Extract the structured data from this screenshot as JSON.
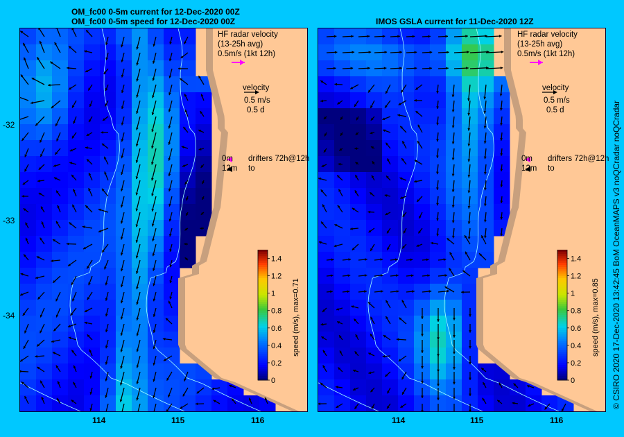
{
  "left_panel": {
    "title_line1": "OM_fc00 0-5m current for 12-Dec-2020 00Z",
    "title_line2": "OM_fc00 0-5m speed for 12-Dec-2020 00Z",
    "colorbar_label": "speed (m/s), max=0.71",
    "max_speed": 0.71
  },
  "right_panel": {
    "title": "IMOS GSLA current for 11-Dec-2020 12Z",
    "colorbar_label": "speed (m/s), max=0.85",
    "max_speed": 0.85
  },
  "annotations": {
    "hf_title": "HF radar velocity",
    "hf_avg": "(13-25h avg)",
    "hf_scale": "0.5m/s (1kt 12h)",
    "velocity": "velocity",
    "vel_speed": "0.5 m/s",
    "vel_time": "0.5 d",
    "drifter_0m": "0m",
    "drifter_label": "drifters 72h@12h",
    "drifter_12m": "12m",
    "drifter_to": "to"
  },
  "axes": {
    "y_ticks": [
      "-32",
      "-33",
      "-34"
    ],
    "x_ticks": [
      "114",
      "115",
      "116"
    ]
  },
  "colorbar": {
    "ticks": [
      "1.4",
      "1.2",
      "1",
      "0.8",
      "0.6",
      "0.4",
      "0.2",
      "0"
    ],
    "range": [
      0,
      1.5
    ]
  },
  "colors": {
    "background": "#00c8ff",
    "land": "#ffc896",
    "shelf": "#c8a07e",
    "hf_arrow": "#ff00ff"
  },
  "credit": "© CSIRO 2020   17-Dec-2020 13:42:45 BoM OceanMAPS v3 noQCradar noQCradar"
}
